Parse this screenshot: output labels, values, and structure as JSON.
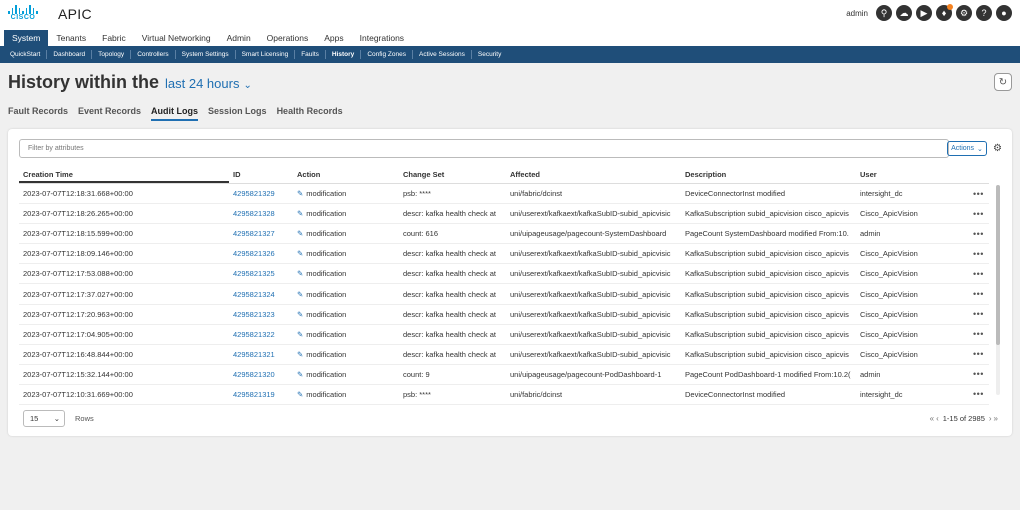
{
  "app": {
    "brand": "CISCO",
    "title": "APIC"
  },
  "user": {
    "name": "admin"
  },
  "top_icons": [
    "search-icon",
    "cloud-icon",
    "video-icon",
    "bell-icon",
    "gear-icon",
    "help-icon",
    "user-icon"
  ],
  "main_nav": [
    "System",
    "Tenants",
    "Fabric",
    "Virtual Networking",
    "Admin",
    "Operations",
    "Apps",
    "Integrations"
  ],
  "sub_nav": [
    "QuickStart",
    "Dashboard",
    "Topology",
    "Controllers",
    "System Settings",
    "Smart Licensing",
    "Faults",
    "History",
    "Config Zones",
    "Active Sessions",
    "Security"
  ],
  "page": {
    "title": "History within the",
    "range": "last 24 hours"
  },
  "record_tabs": [
    "Fault Records",
    "Event Records",
    "Audit Logs",
    "Session Logs",
    "Health Records"
  ],
  "filter": {
    "placeholder": "Filter by attributes"
  },
  "actions_label": "Actions",
  "columns": [
    "Creation Time",
    "ID",
    "Action",
    "Change Set",
    "Affected",
    "Description",
    "User"
  ],
  "rows": [
    {
      "time": "2023-07-07T12:18:31.668+00:00",
      "id": "4295821329",
      "action": "modification",
      "change": "psb: ****",
      "affected": "uni/fabric/dcinst",
      "desc": "DeviceConnectorInst modified",
      "user": "intersight_dc"
    },
    {
      "time": "2023-07-07T12:18:26.265+00:00",
      "id": "4295821328",
      "action": "modification",
      "change": "descr: kafka health check at",
      "affected": "uni/userext/kafkaext/kafkaSubID-subid_apicvisic",
      "desc": "KafkaSubscription subid_apicvision cisco_apicvis",
      "user": "Cisco_ApicVision"
    },
    {
      "time": "2023-07-07T12:18:15.599+00:00",
      "id": "4295821327",
      "action": "modification",
      "change": "count: 616",
      "affected": "uni/uipageusage/pagecount-SystemDashboard",
      "desc": "PageCount SystemDashboard modified From:10.",
      "user": "admin"
    },
    {
      "time": "2023-07-07T12:18:09.146+00:00",
      "id": "4295821326",
      "action": "modification",
      "change": "descr: kafka health check at",
      "affected": "uni/userext/kafkaext/kafkaSubID-subid_apicvisic",
      "desc": "KafkaSubscription subid_apicvision cisco_apicvis",
      "user": "Cisco_ApicVision"
    },
    {
      "time": "2023-07-07T12:17:53.088+00:00",
      "id": "4295821325",
      "action": "modification",
      "change": "descr: kafka health check at",
      "affected": "uni/userext/kafkaext/kafkaSubID-subid_apicvisic",
      "desc": "KafkaSubscription subid_apicvision cisco_apicvis",
      "user": "Cisco_ApicVision"
    },
    {
      "time": "2023-07-07T12:17:37.027+00:00",
      "id": "4295821324",
      "action": "modification",
      "change": "descr: kafka health check at",
      "affected": "uni/userext/kafkaext/kafkaSubID-subid_apicvisic",
      "desc": "KafkaSubscription subid_apicvision cisco_apicvis",
      "user": "Cisco_ApicVision"
    },
    {
      "time": "2023-07-07T12:17:20.963+00:00",
      "id": "4295821323",
      "action": "modification",
      "change": "descr: kafka health check at",
      "affected": "uni/userext/kafkaext/kafkaSubID-subid_apicvisic",
      "desc": "KafkaSubscription subid_apicvision cisco_apicvis",
      "user": "Cisco_ApicVision"
    },
    {
      "time": "2023-07-07T12:17:04.905+00:00",
      "id": "4295821322",
      "action": "modification",
      "change": "descr: kafka health check at",
      "affected": "uni/userext/kafkaext/kafkaSubID-subid_apicvisic",
      "desc": "KafkaSubscription subid_apicvision cisco_apicvis",
      "user": "Cisco_ApicVision"
    },
    {
      "time": "2023-07-07T12:16:48.844+00:00",
      "id": "4295821321",
      "action": "modification",
      "change": "descr: kafka health check at",
      "affected": "uni/userext/kafkaext/kafkaSubID-subid_apicvisic",
      "desc": "KafkaSubscription subid_apicvision cisco_apicvis",
      "user": "Cisco_ApicVision"
    },
    {
      "time": "2023-07-07T12:15:32.144+00:00",
      "id": "4295821320",
      "action": "modification",
      "change": "count: 9",
      "affected": "uni/uipageusage/pagecount-PodDashboard-1",
      "desc": "PageCount PodDashboard-1 modified From:10.2(",
      "user": "admin"
    },
    {
      "time": "2023-07-07T12:10:31.669+00:00",
      "id": "4295821319",
      "action": "modification",
      "change": "psb: ****",
      "affected": "uni/fabric/dcinst",
      "desc": "DeviceConnectorInst modified",
      "user": "intersight_dc"
    }
  ],
  "pagination": {
    "per_page": "15",
    "rows_label": "Rows",
    "range": "1-15 of 2985"
  },
  "colors": {
    "nav": "#1f4e79",
    "link": "#1f6fb2",
    "brand": "#049fd9",
    "notify": "#f58220"
  }
}
